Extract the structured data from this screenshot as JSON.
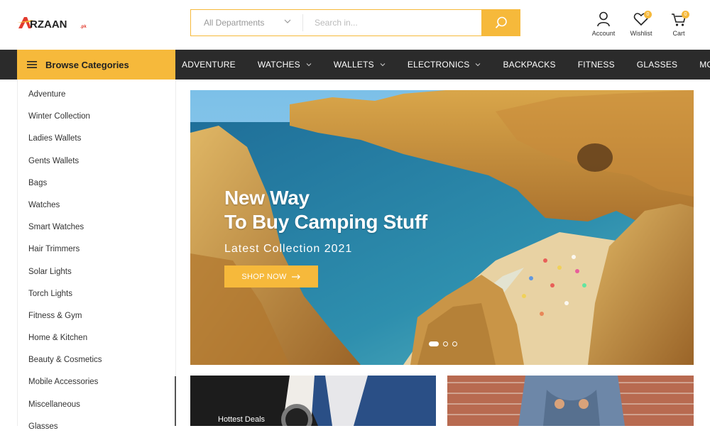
{
  "brand": {
    "logo_text": "ARZAAN",
    "logo_suffix": ".pk"
  },
  "search": {
    "department": "All Departments",
    "placeholder": "Search in..."
  },
  "header_icons": {
    "account": "Account",
    "wishlist": "Wishlist",
    "wishlist_count": "0",
    "cart": "Cart",
    "cart_count": "0"
  },
  "nav": {
    "browse_label": "Browse Categories",
    "items": [
      {
        "label": "ADVENTURE",
        "dropdown": false
      },
      {
        "label": "WATCHES",
        "dropdown": true
      },
      {
        "label": "WALLETS",
        "dropdown": true
      },
      {
        "label": "ELECTRONICS",
        "dropdown": true
      },
      {
        "label": "BACKPACKS",
        "dropdown": false
      },
      {
        "label": "FITNESS",
        "dropdown": false
      },
      {
        "label": "GLASSES",
        "dropdown": false
      },
      {
        "label": "MORE",
        "dropdown": false
      }
    ]
  },
  "categories": [
    "Adventure",
    "Winter Collection",
    "Ladies Wallets",
    "Gents Wallets",
    "Bags",
    "Watches",
    "Smart Watches",
    "Hair Trimmers",
    "Solar Lights",
    "Torch Lights",
    "Fitness & Gym",
    "Home & Kitchen",
    "Beauty & Cosmetics",
    "Mobile Accessories",
    "Miscellaneous",
    "Glasses"
  ],
  "hero": {
    "title_line1": "New Way",
    "title_line2": "To Buy Camping Stuff",
    "subtitle": "Latest Collection 2021",
    "cta": "SHOP NOW",
    "slide_count": 3,
    "active_slide": 1
  },
  "banners": {
    "left_label": "Hottest Deals"
  },
  "colors": {
    "accent": "#f6b93b",
    "nav_bg": "#2b2b2b",
    "logo_red": "#e23b2e"
  },
  "icons": [
    "hamburger-icon",
    "search-icon",
    "user-icon",
    "heart-icon",
    "cart-icon",
    "chevron-down-icon",
    "arrow-right-icon"
  ]
}
